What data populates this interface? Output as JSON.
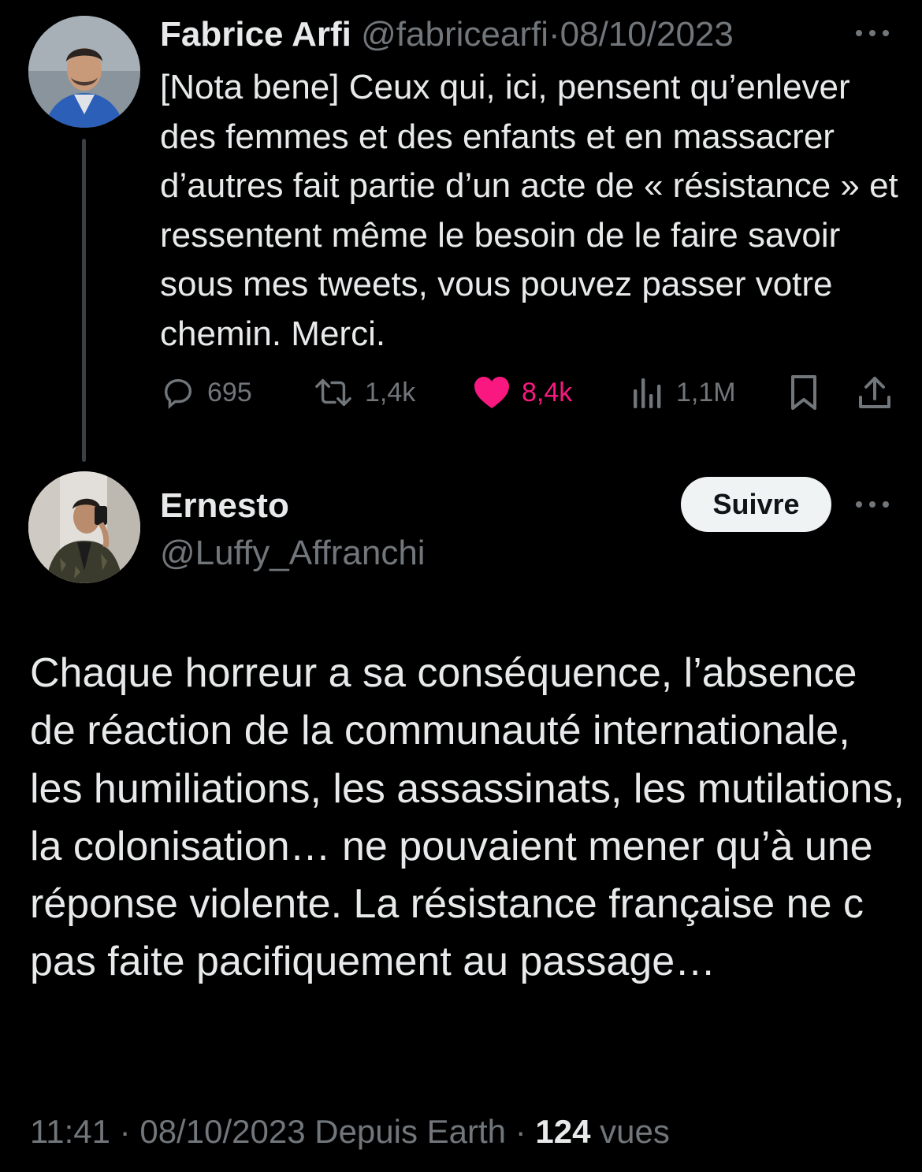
{
  "parent_tweet": {
    "author_name": "Fabrice Arfi",
    "handle": "@fabricearfi",
    "separator": "·",
    "date": "08/10/2023",
    "text": "[Nota bene] Ceux qui, ici, pensent qu’enlever des femmes et des enfants et en massacrer d’autres fait partie d’un acte de « résistance » et ressentent même le besoin de le faire savoir sous mes tweets, vous pouvez passer votre chemin. Merci.",
    "stats": {
      "replies": "695",
      "retweets": "1,4k",
      "likes": "8,4k",
      "views": "1,1M"
    },
    "icons": {
      "reply": "reply-icon",
      "retweet": "retweet-icon",
      "like": "heart-filled-icon",
      "views": "views-bar-chart-icon",
      "bookmark": "bookmark-icon",
      "share": "share-icon",
      "more": "more-dots-icon"
    }
  },
  "reply_tweet": {
    "author_name": "Ernesto",
    "handle": "@Luffy_Affranchi",
    "follow_label": "Suivre",
    "text": "Chaque horreur a sa conséquence, l’absence de réaction de la communauté internationale, les humiliations, les assassinats, les mutilations, la colonisation… ne pouvaient mener qu’à une réponse violente. La résistance française ne c pas faite pacifiquement au passage…",
    "time": "11:41",
    "separator": "·",
    "date": "08/10/2023",
    "source": "Depuis Earth",
    "separator2": "·",
    "views_count": "124",
    "views_label": "vues"
  },
  "colors": {
    "background": "#000000",
    "text_primary": "#e7e9ea",
    "text_secondary": "#71767b",
    "like_pink": "#f91880",
    "thread_line": "#3a3f44",
    "follow_bg": "#eff3f4"
  }
}
